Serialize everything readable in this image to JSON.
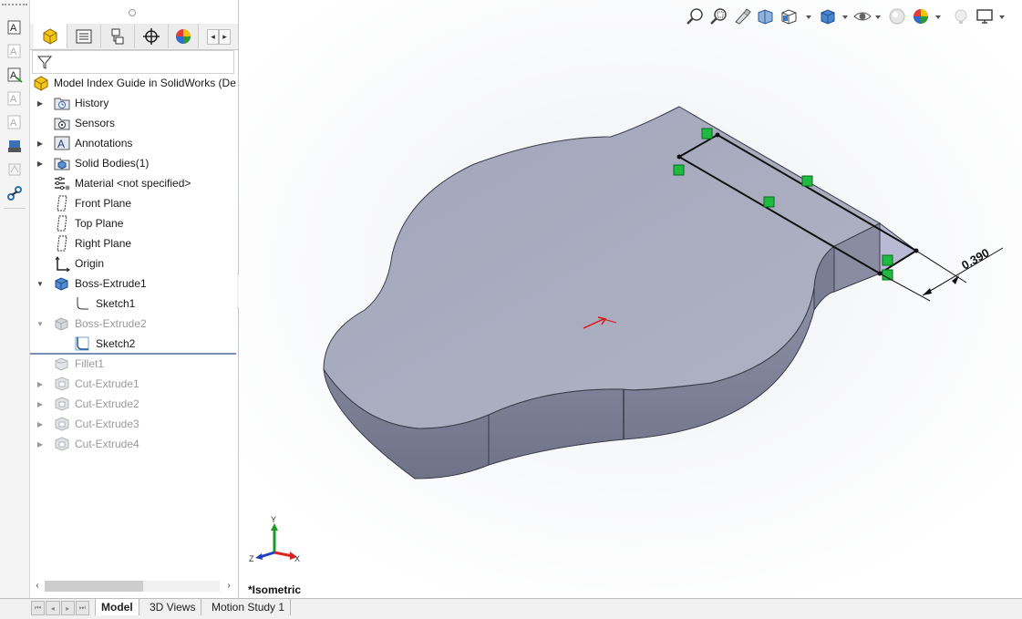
{
  "feature_tree": {
    "root_label": "Model Index Guide in SolidWorks  (De",
    "items": [
      {
        "label": "History",
        "icon": "history-folder-icon",
        "expandable": true,
        "dim": false
      },
      {
        "label": "Sensors",
        "icon": "sensors-icon",
        "expandable": false,
        "dim": false
      },
      {
        "label": "Annotations",
        "icon": "annotations-icon",
        "expandable": true,
        "dim": false
      },
      {
        "label": "Solid Bodies(1)",
        "icon": "solid-bodies-icon",
        "expandable": true,
        "dim": false
      },
      {
        "label": "Material <not specified>",
        "icon": "material-icon",
        "expandable": false,
        "dim": false
      },
      {
        "label": "Front Plane",
        "icon": "plane-icon",
        "expandable": false,
        "dim": false
      },
      {
        "label": "Top Plane",
        "icon": "plane-icon",
        "expandable": false,
        "dim": false
      },
      {
        "label": "Right Plane",
        "icon": "plane-icon",
        "expandable": false,
        "dim": false
      },
      {
        "label": "Origin",
        "icon": "origin-icon",
        "expandable": false,
        "dim": false
      },
      {
        "label": "Boss-Extrude1",
        "icon": "extrude-icon",
        "expandable": true,
        "expanded": true,
        "dim": false
      },
      {
        "label": "Sketch1",
        "icon": "sketch-icon",
        "child": true,
        "dim": false
      },
      {
        "label": "Boss-Extrude2",
        "icon": "extrude-icon",
        "expandable": true,
        "expanded": true,
        "dim": true
      },
      {
        "label": "Sketch2",
        "icon": "sketch-icon",
        "child": true,
        "dim": false
      },
      {
        "label": "Fillet1",
        "icon": "fillet-icon",
        "expandable": false,
        "dim": true
      },
      {
        "label": "Cut-Extrude1",
        "icon": "cut-extrude-icon",
        "expandable": true,
        "dim": true
      },
      {
        "label": "Cut-Extrude2",
        "icon": "cut-extrude-icon",
        "expandable": true,
        "dim": true
      },
      {
        "label": "Cut-Extrude3",
        "icon": "cut-extrude-icon",
        "expandable": true,
        "dim": true
      },
      {
        "label": "Cut-Extrude4",
        "icon": "cut-extrude-icon",
        "expandable": true,
        "dim": true
      }
    ]
  },
  "bottom_tabs": [
    "Model",
    "3D Views",
    "Motion Study 1"
  ],
  "active_tab": "Model",
  "graphics": {
    "view_orientation": "*Isometric",
    "dimension_value": "0.390",
    "triad": {
      "x": "X",
      "y": "Y",
      "z": "Z"
    }
  },
  "colors": {
    "model_top": "#a9abbe",
    "model_side": "#7e8196",
    "sketch_relation": "#18b83a",
    "rollback_bar": "#7b8fb4"
  }
}
